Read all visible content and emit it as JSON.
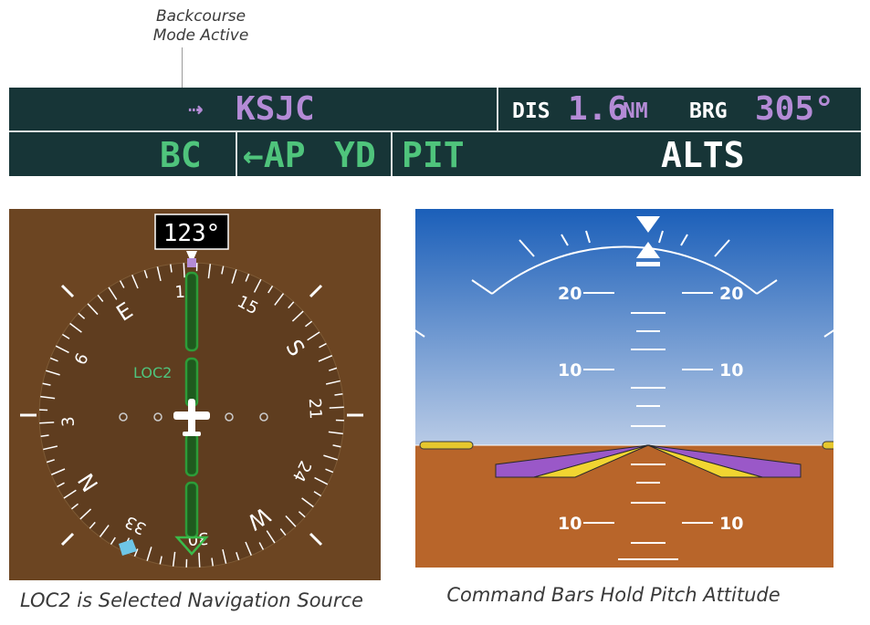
{
  "callout": {
    "line1": "Backcourse",
    "line2": "Mode Active"
  },
  "nav_status": {
    "arrow_symbol": "⇢",
    "waypoint": "KSJC",
    "dis_label": "DIS",
    "dis_value": "1.6",
    "dis_unit": "NM",
    "brg_label": "BRG",
    "brg_value": "305°"
  },
  "afcs_status": {
    "lateral_mode": "BC",
    "ap": "←AP",
    "yd": "YD",
    "vertical_mode": "PIT",
    "armed_vertical": "ALTS"
  },
  "hsi": {
    "heading": "123°",
    "nav_source": "LOC2",
    "compass_labels": [
      "E",
      "12",
      "15",
      "S",
      "21",
      "24",
      "W",
      "30",
      "33",
      "N",
      "3",
      "6"
    ]
  },
  "adi": {
    "pitch_labels": [
      "20",
      "20",
      "10",
      "10",
      "10",
      "10"
    ]
  },
  "captions": {
    "left": "LOC2 is Selected Navigation Source",
    "right": "Command Bars Hold Pitch Attitude"
  },
  "colors": {
    "status_bar_bg": "#173537",
    "green_mode": "#4fc47c",
    "magenta": "#b48bd6",
    "hsi_bg": "#6c4522",
    "sky_top": "#1e5fb8",
    "ground": "#b8652a",
    "cdi_green": "#3bbb4a"
  }
}
